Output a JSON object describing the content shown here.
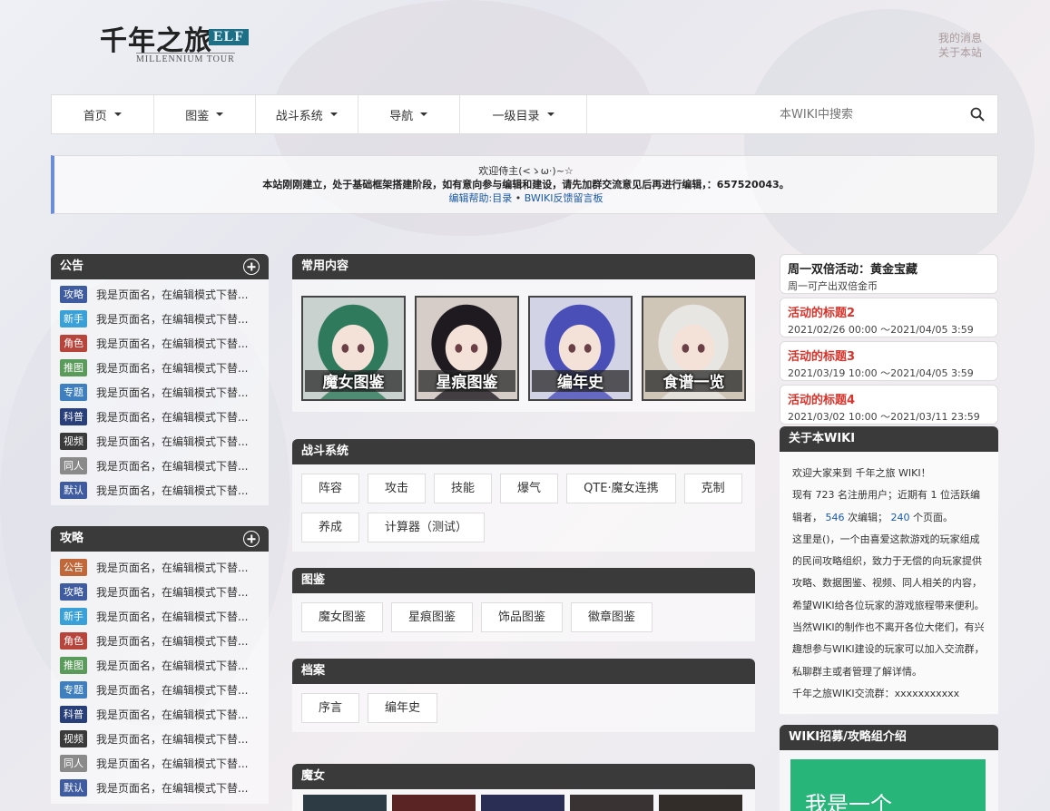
{
  "header": {
    "logo_cn": "千年之旅",
    "logo_tag": "ELF",
    "logo_en": "MILLENNIUM TOUR",
    "links": [
      "我的消息",
      "关于本站"
    ]
  },
  "nav": {
    "items": [
      "首页",
      "图鉴",
      "战斗系统",
      "导航",
      "一级目录"
    ],
    "search_placeholder": "本WIKI中搜索"
  },
  "notice": {
    "line1": "欢迎侍主(<ゝω·)~☆",
    "line2": "本站刚刚建立，处于基础框架搭建阶段，如有意向参与编辑和建设，请先加群交流意见后再进行编辑，：657520043。",
    "link1": "编辑帮助:目录",
    "sep": "•",
    "link2": "BWIKI反馈留言板"
  },
  "announcements": {
    "title": "公告",
    "items": [
      {
        "tag": "攻略",
        "color": "#3f5ca0",
        "text": "我是页面名，在编辑模式下替..."
      },
      {
        "tag": "新手",
        "color": "#3aa0d8",
        "text": "我是页面名，在编辑模式下替..."
      },
      {
        "tag": "角色",
        "color": "#b7453c",
        "text": "我是页面名，在编辑模式下替..."
      },
      {
        "tag": "推图",
        "color": "#5a9a5a",
        "text": "我是页面名，在编辑模式下替..."
      },
      {
        "tag": "专题",
        "color": "#3f7fc0",
        "text": "我是页面名，在编辑模式下替..."
      },
      {
        "tag": "科普",
        "color": "#283f7a",
        "text": "我是页面名，在编辑模式下替..."
      },
      {
        "tag": "视频",
        "color": "#3a3a3a",
        "text": "我是页面名，在编辑模式下替..."
      },
      {
        "tag": "同人",
        "color": "#8a8a8a",
        "text": "我是页面名，在编辑模式下替..."
      },
      {
        "tag": "默认",
        "color": "#3f5ca0",
        "text": "我是页面名，在编辑模式下替..."
      }
    ]
  },
  "guides": {
    "title": "攻略",
    "items": [
      {
        "tag": "公告",
        "color": "#c0683a",
        "text": "我是页面名，在编辑模式下替..."
      },
      {
        "tag": "攻略",
        "color": "#3f5ca0",
        "text": "我是页面名，在编辑模式下替..."
      },
      {
        "tag": "新手",
        "color": "#3aa0d8",
        "text": "我是页面名，在编辑模式下替..."
      },
      {
        "tag": "角色",
        "color": "#b7453c",
        "text": "我是页面名，在编辑模式下替..."
      },
      {
        "tag": "推图",
        "color": "#5a9a5a",
        "text": "我是页面名，在编辑模式下替..."
      },
      {
        "tag": "专题",
        "color": "#3f7fc0",
        "text": "我是页面名，在编辑模式下替..."
      },
      {
        "tag": "科普",
        "color": "#283f7a",
        "text": "我是页面名，在编辑模式下替..."
      },
      {
        "tag": "视频",
        "color": "#3a3a3a",
        "text": "我是页面名，在编辑模式下替..."
      },
      {
        "tag": "同人",
        "color": "#8a8a8a",
        "text": "我是页面名，在编辑模式下替..."
      },
      {
        "tag": "默认",
        "color": "#3f5ca0",
        "text": "我是页面名，在编辑模式下替..."
      }
    ]
  },
  "common": {
    "title": "常用内容",
    "cards": [
      {
        "label": "魔女图鉴",
        "hair": "#2f7a5c",
        "bg": "#c9d2cf"
      },
      {
        "label": "星痕图鉴",
        "hair": "#1e1a20",
        "bg": "#d6cdc9"
      },
      {
        "label": "编年史",
        "hair": "#4a4fb8",
        "bg": "#d2d3e4"
      },
      {
        "label": "食谱一览",
        "hair": "#e8e6e2",
        "bg": "#cfc6b7"
      }
    ]
  },
  "combat": {
    "title": "战斗系统",
    "buttons": [
      "阵容",
      "攻击",
      "技能",
      "爆气",
      "QTE·魔女连携",
      "克制",
      "养成",
      "计算器（测试）"
    ]
  },
  "gallery": {
    "title": "图鉴",
    "buttons": [
      "魔女图鉴",
      "星痕图鉴",
      "饰品图鉴",
      "徽章图鉴"
    ]
  },
  "archive": {
    "title": "档案",
    "buttons": [
      "序言",
      "编年史"
    ]
  },
  "witch": {
    "title": "魔女"
  },
  "events": [
    {
      "title": "周一双倍活动：黄金宝藏",
      "sub": "周一可产出双倍金币",
      "red": false
    },
    {
      "title": "活动的标题2",
      "sub": "2021/02/26 00:00 ～2021/04/05 3:59",
      "red": true
    },
    {
      "title": "活动的标题3",
      "sub": "2021/03/19 10:00 ～2021/04/05 3:59",
      "red": true
    },
    {
      "title": "活动的标题4",
      "sub": "2021/03/02 10:00 ～2021/03/11 23:59",
      "red": true
    }
  ],
  "about": {
    "title": "关于本WIKI",
    "welcome": "欢迎大家来到 千年之旅 WIKI！",
    "stats_a": "现有 723 名注册用户；近期有 1 位活跃编辑者，",
    "edits": "546",
    "stats_b": " 次编辑；",
    "pages": "240",
    "stats_c": " 个页面。",
    "para1": "这里是()，一个由喜爱这款游戏的玩家组成的民间攻略组织，致力于无偿的向玩家提供攻略、数据图鉴、视频、同人相关的内容，希望WIKI给各位玩家的游戏旅程带来便利。",
    "para2": "当然WIKI的制作也不离开各位大佬们，有兴趣想参与WIKI建设的玩家可以加入交流群，私聊群主或者管理了解详情。",
    "group": "千年之旅WIKI交流群：xxxxxxxxxxx"
  },
  "recruit": {
    "title": "WIKI招募/攻略组介绍",
    "img_text": "我是一个"
  }
}
